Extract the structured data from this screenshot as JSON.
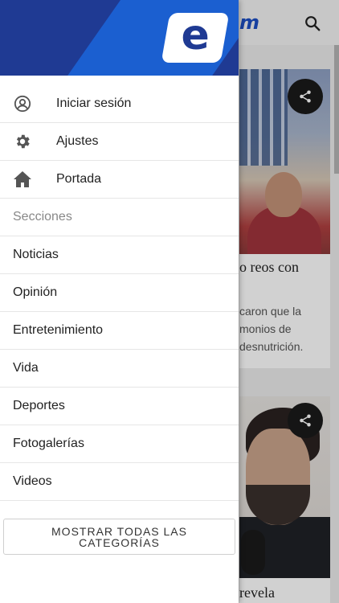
{
  "brand": {
    "logo_letter": "e",
    "bg_logo_text": "m"
  },
  "drawer": {
    "account_items": [
      {
        "label": "Iniciar sesión",
        "icon": "user-circle-icon"
      },
      {
        "label": "Ajustes",
        "icon": "gear-icon"
      },
      {
        "label": "Portada",
        "icon": "home-icon"
      }
    ],
    "sections_heading": "Secciones",
    "sections": [
      {
        "label": "Noticias"
      },
      {
        "label": "Opinión"
      },
      {
        "label": "Entretenimiento"
      },
      {
        "label": "Vida"
      },
      {
        "label": "Deportes"
      },
      {
        "label": "Fotogalerías"
      },
      {
        "label": "Videos"
      }
    ],
    "show_all_label": "MOSTRAR TODAS LAS CATEGORÍAS"
  },
  "background_page": {
    "articles": [
      {
        "title_fragment": "o reos con",
        "text_lines": [
          "caron que la",
          "monios de",
          "desnutrición."
        ]
      },
      {
        "title_fragment": "revela"
      }
    ]
  },
  "colors": {
    "brand_blue": "#1f3a93",
    "accent_blue": "#1b5fd0"
  }
}
